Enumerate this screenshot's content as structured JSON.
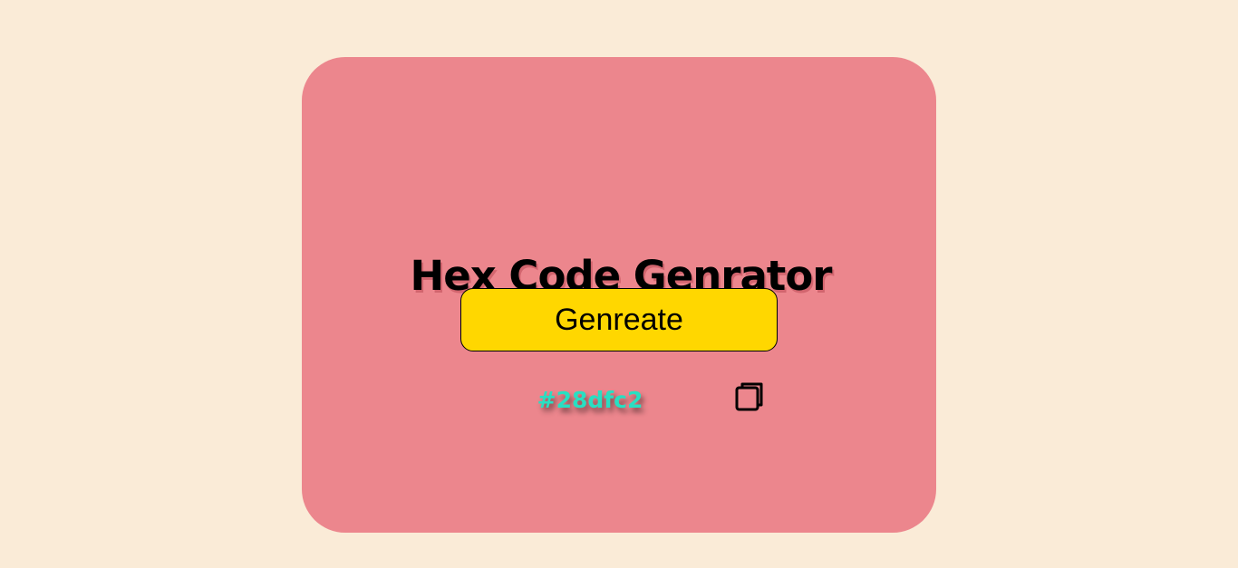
{
  "colors": {
    "page_background": "#faebd7",
    "card_background": "#ec868d",
    "button_background": "#ffd700",
    "hex_text": "#28dfc2"
  },
  "app": {
    "title": "Hex Code Genrator"
  },
  "generate_button": {
    "label": "Genreate"
  },
  "result": {
    "hex_code": "#28dfc2"
  },
  "copy": {
    "icon": "copy-icon"
  }
}
